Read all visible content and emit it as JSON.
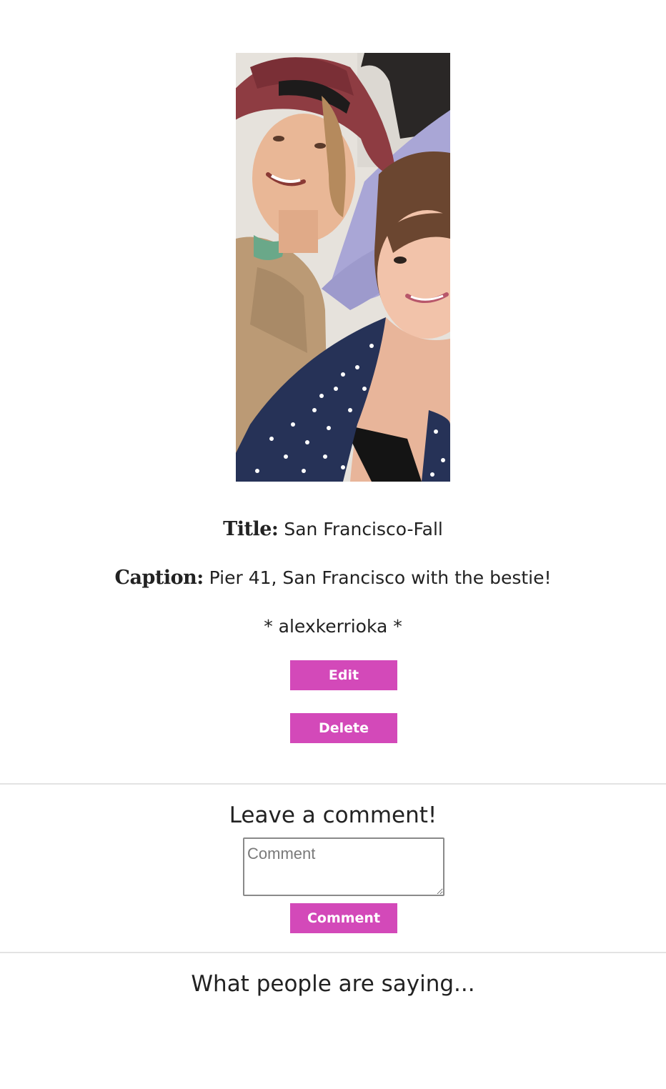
{
  "post": {
    "title_label": "Title:",
    "title_value": "San Francisco-Fall",
    "caption_label": "Caption:",
    "caption_value": "Pier 41, San Francisco with the bestie!",
    "author": "* alexkerrioka *"
  },
  "actions": {
    "edit_label": "Edit",
    "delete_label": "Delete"
  },
  "comment_form": {
    "heading": "Leave a comment!",
    "placeholder": "Comment",
    "submit_label": "Comment"
  },
  "comments_section": {
    "heading": "What people are saying..."
  },
  "colors": {
    "button": "#d349b9",
    "divider": "#e3e3e3",
    "text": "#222222"
  }
}
